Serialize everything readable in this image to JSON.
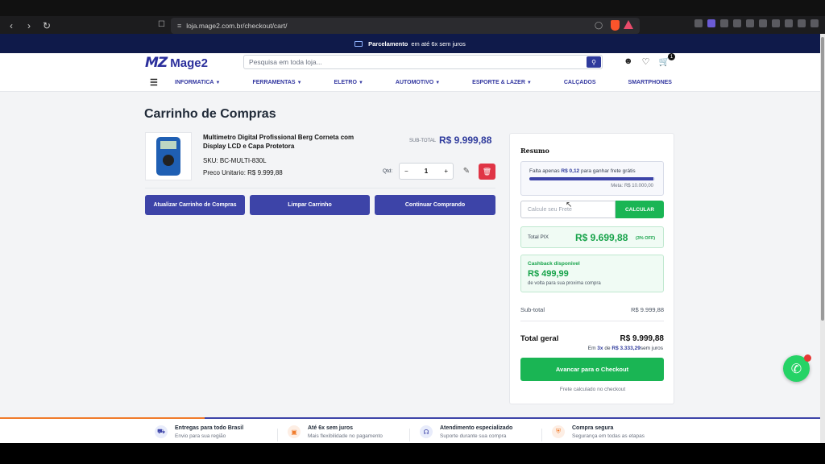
{
  "browser": {
    "url": "loja.mage2.com.br/checkout/cart/"
  },
  "promo": {
    "bold": "Parcelamento",
    "text": "em até 6x sem juros"
  },
  "header": {
    "logo_mark": "MZ",
    "logo_text": "Mage2",
    "search_placeholder": "Pesquisa em toda loja...",
    "cart_count": "1"
  },
  "menu": [
    {
      "label": "INFORMATICA",
      "chevron": true
    },
    {
      "label": "FERRAMENTAS",
      "chevron": true
    },
    {
      "label": "ELETRO",
      "chevron": true
    },
    {
      "label": "AUTOMOTIVO",
      "chevron": true
    },
    {
      "label": "ESPORTE & LAZER",
      "chevron": true
    },
    {
      "label": "CALÇADOS",
      "chevron": false
    },
    {
      "label": "SMARTPHONES",
      "chevron": false
    }
  ],
  "page_title": "Carrinho de Compras",
  "item": {
    "name": "Multimetro Digital Profissional Berg Corneta com Display LCD e Capa Protetora",
    "sku": "SKU: BC-MULTI-830L",
    "unit_price": "Preco Unitario: R$ 9.999,88",
    "subtotal_label": "SUB-TOTAL",
    "subtotal": "R$ 9.999,88",
    "qty_label": "Qtd:",
    "qty": "1"
  },
  "actions": {
    "update": "Atualizar Carrinho de Compras",
    "clear": "Limpar Carrinho",
    "continue": "Continuar Comprando"
  },
  "summary": {
    "title": "Resumo",
    "ship_prefix": "Falta apenas",
    "ship_amount": "R$ 0,12",
    "ship_suffix": "para ganhar frete grátis",
    "ship_progress": 0.99,
    "goal": "Meta: R$ 10.000,00",
    "frete_placeholder": "Calcule seu Frete",
    "frete_button": "CALCULAR",
    "pix_label": "Total PIX",
    "pix_value": "R$ 9.699,88",
    "pix_off": "(3% OFF)",
    "cashback_label": "Cashback disponivel",
    "cashback_value": "R$ 499,99",
    "cashback_note": "de volta para sua proxima compra",
    "subtotal_label": "Sub-total",
    "subtotal_value": "R$ 9.999,88",
    "total_label": "Total geral",
    "total_value": "R$ 9.999,88",
    "inst_prefix": "Em",
    "inst_times": "3x",
    "inst_mid": "de",
    "inst_amount": "R$ 3.333,29",
    "inst_suffix": "sem juros",
    "checkout_button": "Avancar para o Checkout",
    "frete_note": "Frete calculado no checkout"
  },
  "features": [
    {
      "title": "Entregas para todo Brasil",
      "sub": "Envio para sua região",
      "icon": "truck-icon",
      "color": "#e8ecfb",
      "fg": "#3d44a8"
    },
    {
      "title": "Até 6x sem juros",
      "sub": "Mais flexibilidade no pagamento",
      "icon": "credit-card-icon",
      "color": "#fdeee4",
      "fg": "#f07b2a"
    },
    {
      "title": "Atendimento especializado",
      "sub": "Suporte durante sua compra",
      "icon": "headset-icon",
      "color": "#e8ecfb",
      "fg": "#3d44a8"
    },
    {
      "title": "Compra segura",
      "sub": "Segurança em todas as etapas",
      "icon": "shield-icon",
      "color": "#fdeee4",
      "fg": "#f07b2a"
    }
  ],
  "colors": {
    "brand": "#3d44a8",
    "accent_green": "#1ab554",
    "danger": "#e03546",
    "promo_bg": "#0f1a4a"
  }
}
